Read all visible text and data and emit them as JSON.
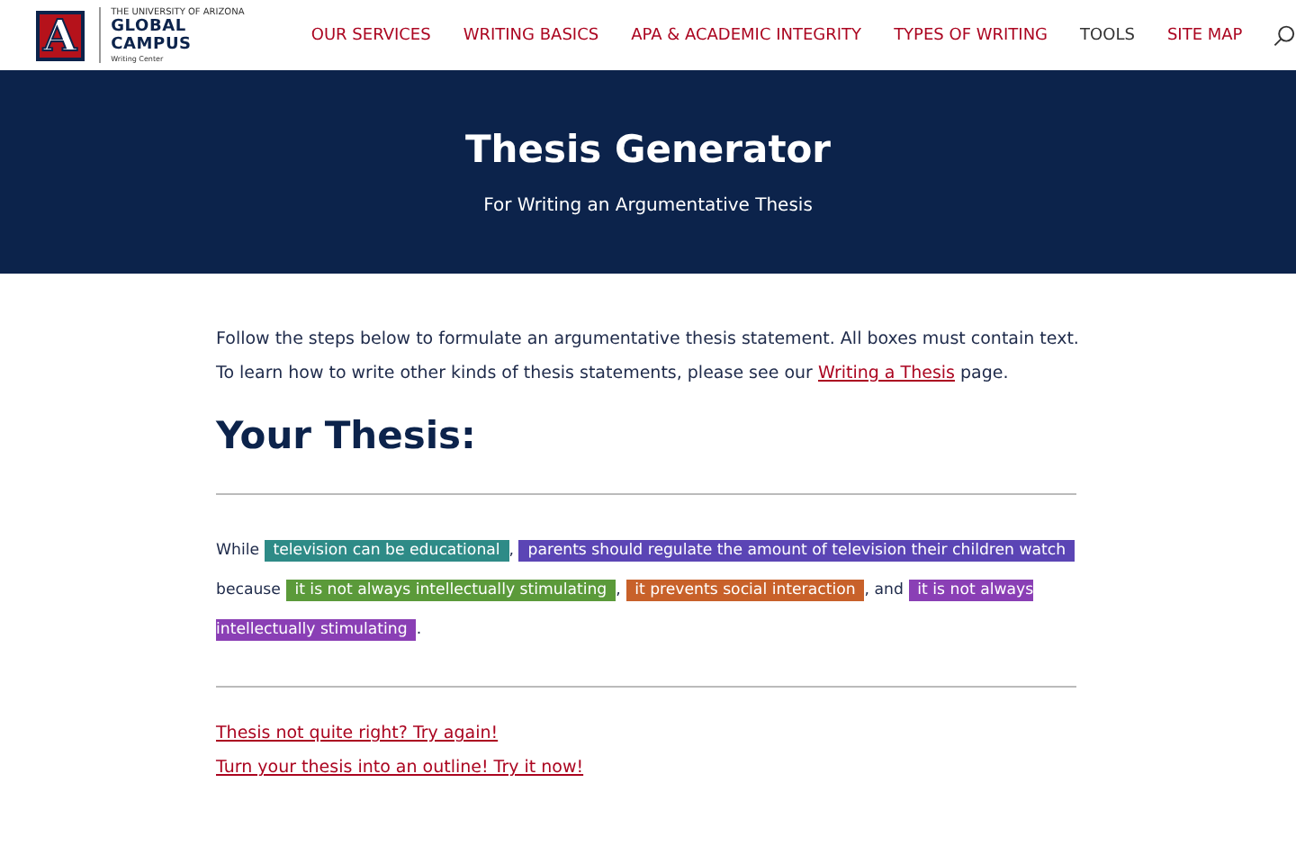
{
  "header": {
    "logo_lines": [
      "THE UNIVERSITY OF ARIZONA",
      "GLOBAL CAMPUS",
      "Writing Center"
    ],
    "logo_mark": "A",
    "nav": [
      {
        "label": "OUR SERVICES",
        "kind": "link"
      },
      {
        "label": "WRITING BASICS",
        "kind": "link"
      },
      {
        "label": "APA & ACADEMIC INTEGRITY",
        "kind": "link"
      },
      {
        "label": "TYPES OF WRITING",
        "kind": "link"
      },
      {
        "label": "TOOLS",
        "kind": "plain"
      },
      {
        "label": "SITE MAP",
        "kind": "link"
      }
    ]
  },
  "banner": {
    "title": "Thesis Generator",
    "subtitle": "For Writing an Argumentative Thesis"
  },
  "intro": {
    "line_1": "Follow the steps below to formulate an argumentative thesis statement. All boxes must contain text.",
    "line_2_before": "To learn how to write other kinds of thesis statements, please see our",
    "link": "Writing a Thesis",
    "line_2_after": "page."
  },
  "heading": "Your Thesis:",
  "thesis": [
    {
      "kind": "text",
      "text": "While"
    },
    {
      "kind": "highlight",
      "text": "television can be educational",
      "color": "#2e8b87"
    },
    {
      "kind": "text",
      "text": ","
    },
    {
      "kind": "highlight",
      "text": "parents should regulate the amount of television their children watch",
      "color": "#5b45b5"
    },
    {
      "kind": "text",
      "text": "because"
    },
    {
      "kind": "highlight",
      "text": "it is not always intellectually stimulating",
      "color": "#5b9a3a"
    },
    {
      "kind": "text",
      "text": ","
    },
    {
      "kind": "highlight",
      "text": "it prevents social interaction",
      "color": "#c8612a"
    },
    {
      "kind": "text",
      "text": ", and"
    },
    {
      "kind": "highlight",
      "text": "it is not always intellectually stimulating",
      "color": "#8a3fb5"
    },
    {
      "kind": "text",
      "text": "."
    }
  ],
  "links": [
    "Thesis not quite right? Try again!",
    "Turn your thesis into an outline! Try it now!"
  ]
}
